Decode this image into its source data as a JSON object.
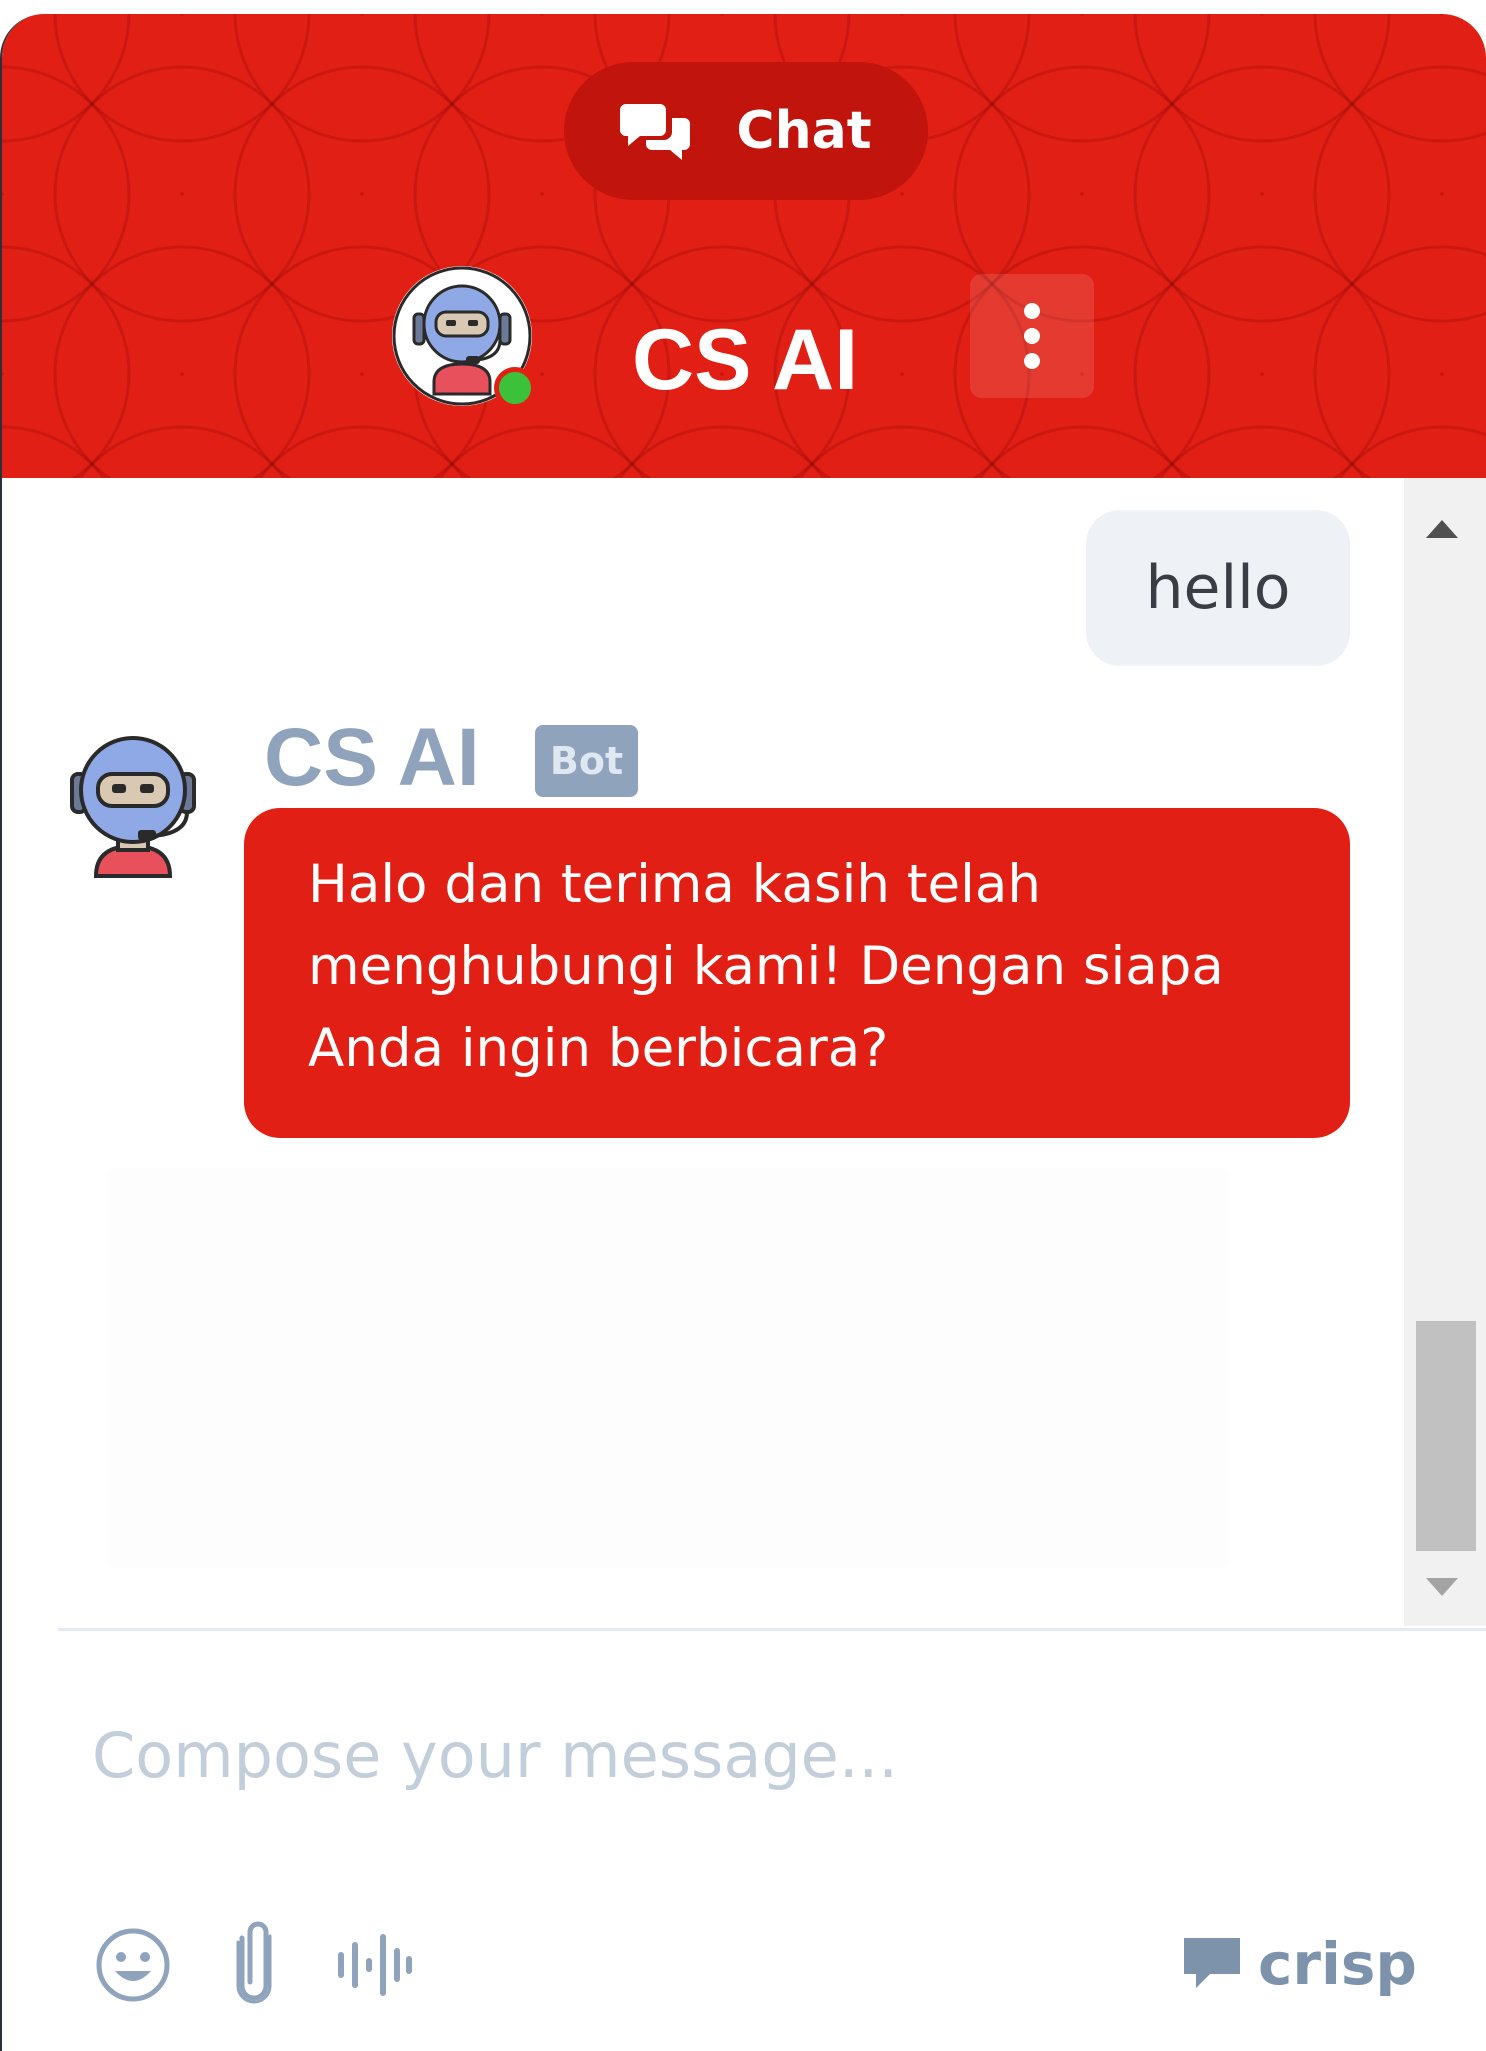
{
  "header": {
    "chat_tab_label": "Chat",
    "agent_name": "CS AI",
    "status": "online",
    "accent_color": "#e11f14"
  },
  "messages": {
    "user_message": "hello",
    "bot_name": "CS AI",
    "bot_badge": "Bot",
    "bot_message": "Halo dan terima kasih telah menghubungi kami! Dengan siapa Anda ingin berbicara?"
  },
  "composer": {
    "placeholder": "Compose your message...",
    "tools": [
      "emoji-icon",
      "attachment-icon",
      "voice-icon"
    ]
  },
  "branding": {
    "label": "crisp",
    "icon": "crisp-chat-icon"
  }
}
